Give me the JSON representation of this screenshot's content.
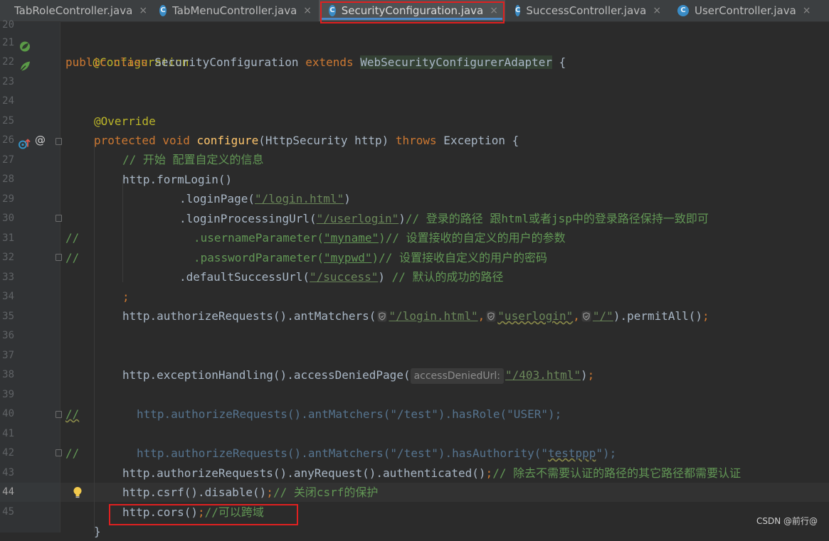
{
  "tabs": [
    {
      "label": "TabRoleController.java",
      "icon": "class-icon",
      "active": false
    },
    {
      "label": "TabMenuController.java",
      "icon": "class-icon",
      "active": false
    },
    {
      "label": "SecurityConfiguration.java",
      "icon": "class-icon",
      "active": true
    },
    {
      "label": "SuccessController.java",
      "icon": "class-icon",
      "active": false
    },
    {
      "label": "UserController.java",
      "icon": "class-icon",
      "active": false
    }
  ],
  "tab_icon_letter": "C",
  "close_glyph": "×",
  "line_numbers": [
    "20",
    "21",
    "22",
    "23",
    "24",
    "25",
    "26",
    "27",
    "28",
    "29",
    "30",
    "31",
    "32",
    "33",
    "34",
    "35",
    "36",
    "37",
    "38",
    "39",
    "40",
    "41",
    "42",
    "43",
    "44",
    "45"
  ],
  "current_line": "44",
  "gutter_at_symbol": "@",
  "code": {
    "l21_annotation": "@Configuration",
    "l22_public": "public",
    "l22_class": "class",
    "l22_name": "SecurityConfiguration",
    "l22_extends": "extends",
    "l22_parent": "WebSecurityConfigurerAdapter",
    "l22_brace": " {",
    "l25_annotation": "@Override",
    "l26_protected": "protected",
    "l26_void": "void",
    "l26_method": "configure",
    "l26_params": "(HttpSecurity http) ",
    "l26_throws": "throws",
    "l26_exception": " Exception {",
    "l27_comment": "// 开始 配置自定义的信息",
    "l28_text": "http.formLogin()",
    "l29_pre": ".loginPage(",
    "l29_str": "\"/login.html\"",
    "l29_post": ")",
    "l30_pre": ".loginProcessingUrl(",
    "l30_str": "\"/userlogin\"",
    "l30_post": ")",
    "l30_comment": "// 登录的路径 跟html或者jsp中的登录路径保持一致即可",
    "l31_slash": "//",
    "l31_pre": ".usernameParameter(",
    "l31_str": "\"myname\"",
    "l31_post": ")// 设置接收的自定义的用户的参数",
    "l32_slash": "//",
    "l32_pre": ".passwordParameter(",
    "l32_str": "\"mypwd\"",
    "l32_post": ")// 设置接收自定义的用户的密码",
    "l33_pre": ".defaultSuccessUrl(",
    "l33_str": "\"/success\"",
    "l33_post": ") ",
    "l33_comment": "// 默认的成功的路径",
    "l34_semi": ";",
    "l35_pre": "http.authorizeRequests().antMatchers(",
    "l35_s1": "\"/login.html\"",
    "l35_c1": ",",
    "l35_s2": "\"userlogin\"",
    "l35_c2": ",",
    "l35_s3": "\"/\"",
    "l35_post": ").permitAll()",
    "l35_semi": ";",
    "l38_pre": "http.exceptionHandling().accessDeniedPage(",
    "l38_hint": "accessDeniedUrl:",
    "l38_str": "\"/403.html\"",
    "l38_post": ")",
    "l38_semi": ";",
    "l40_slash": "//",
    "l40_text": "http.authorizeRequests().antMatchers(\"/test\").hasRole(\"USER\");",
    "l42_slash": "//",
    "l42_pre": "http.authorizeRequests().antMatchers(\"/test\").hasAuthority(\"",
    "l42_wavy": "testppp",
    "l42_post": "\");",
    "l43_text": "http.authorizeRequests().anyRequest().authenticated()",
    "l43_semi": ";",
    "l43_comment": "// 除去不需要认证的路径的其它路径都需要认证",
    "l44_text": "http.csrf().disable()",
    "l44_semi": ";",
    "l44_comment": "// 关闭csrf的保护",
    "l45_text": "http.cors()",
    "l45_semi": ";",
    "l45_comment": "//可以跨域",
    "l46_brace": "}"
  },
  "watermark": "CSDN @前行@",
  "colors": {
    "background": "#2b2b2b",
    "keyword": "#cc7832",
    "string": "#6a8759",
    "comment": "#629755",
    "annotation": "#bbb529",
    "method_decl": "#ffc66d",
    "highlight_box": "#e02020",
    "active_tab_underline": "#4a88c7"
  }
}
